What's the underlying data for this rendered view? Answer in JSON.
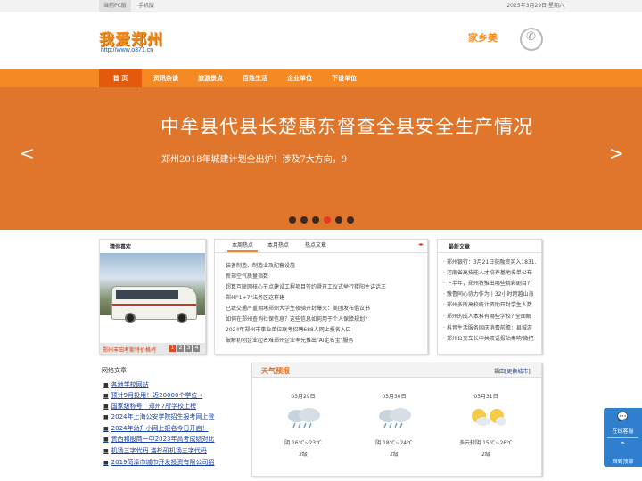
{
  "topbar": {
    "pc_label": "当前PC版",
    "mobile_label": "手机版",
    "date": "2025年3月29日 星期六"
  },
  "header": {
    "logo_text": "我爱郑州",
    "url": "http://www.o371.cn",
    "hometown_label": "家乡美",
    "phone_icon": "phone-icon"
  },
  "nav": {
    "items": [
      "首 页",
      "资讯杂谈",
      "旅游景点",
      "百姓生活",
      "企业单位",
      "下设单位"
    ],
    "active_index": 0
  },
  "banner": {
    "title": "中牟县代县长楚惠东督查全县安全生产情况",
    "subtitle": "郑州2018年城建计划全出炉！涉及7大方向，9",
    "prev_arrow": "<",
    "next_arrow": ">",
    "dot_count": 6,
    "active_dot": 3,
    "bg_color": "#e0752c"
  },
  "photo": {
    "title": "猜你喜欢",
    "caption": "郑州丰田考斯特价格柯",
    "pages": [
      "1",
      "2",
      "3",
      "4"
    ],
    "active_page": 0
  },
  "news": {
    "tabs": [
      "本周热点",
      "本月热点",
      "热点文章"
    ],
    "active_tab": 0,
    "tab_arrows": "◂▸",
    "items": [
      "装备制造、制造业及配套设施",
      "新郑空气质量指数",
      "超算互联网核心节点建设工程项目签约暨开工仪式举行楼阳生讲话王",
      "郑州\"1+7\"法务区这样建",
      "已致交通严重拥堵郑州大学生夜骑开封爆火：美团发布倡议书",
      "如何在郑州查询社保信息？这些信息如何用于个人保障规划?",
      "2024年郑州市事业单位联考招聘688人网上报名入口",
      "破解初创企业起名难郑州企业率先推出\"AI定名宝\"服务"
    ]
  },
  "latest": {
    "title": "最新文章",
    "items": [
      "郑州银行：3月21日获融资买入1831.",
      "河南省高技能人才培养基地名单公布",
      "下半年，郑州将推出哪些精彩剧目?",
      "豫鲁同心协力作为丨32小时跨越山海",
      "郑州多所高校统计资助开封学生人数",
      "郑州的成人本科有哪些学校? 全面解",
      "抖音生活服务国庆消费前瞻：县城游",
      "郑州公交车长中共双语报站奏响'微把"
    ]
  },
  "web": {
    "title": "网络文章",
    "items": [
      "各地学校网站",
      "预计9月投用！近20000个学位→",
      "国家级称号！郑州7所学校上榜",
      "2024年上海公安学院招生报考网上登",
      "2024年幼升小网上报名今日开启！",
      "贵西和殷商一中2023年高考成绩对比",
      "机场三字代码 洛杉矶机场三字代码",
      "2019菏泽市城市开发投资有限公司招"
    ]
  },
  "weather": {
    "title": "天气预报",
    "city": "福田",
    "change_label": "[更换城市]",
    "days": [
      {
        "date": "03月29日",
        "desc": "阴 16℃~23℃",
        "wind": "2级",
        "icon": "cloud-rain-icon"
      },
      {
        "date": "03月30日",
        "desc": "阴 18℃~24℃",
        "wind": "2级",
        "icon": "cloud-rain-icon"
      },
      {
        "date": "03月31日",
        "desc": "多云转阴 15℃~26℃",
        "wind": "2级",
        "icon": "sun-cloud-icon"
      }
    ]
  },
  "float": {
    "consult_label": "在线客服",
    "top_label": "回到顶部"
  },
  "colors": {
    "accent": "#f58a25",
    "nav_active": "#e35a0d",
    "link": "#1a3fa6",
    "float": "#2f7fce"
  }
}
